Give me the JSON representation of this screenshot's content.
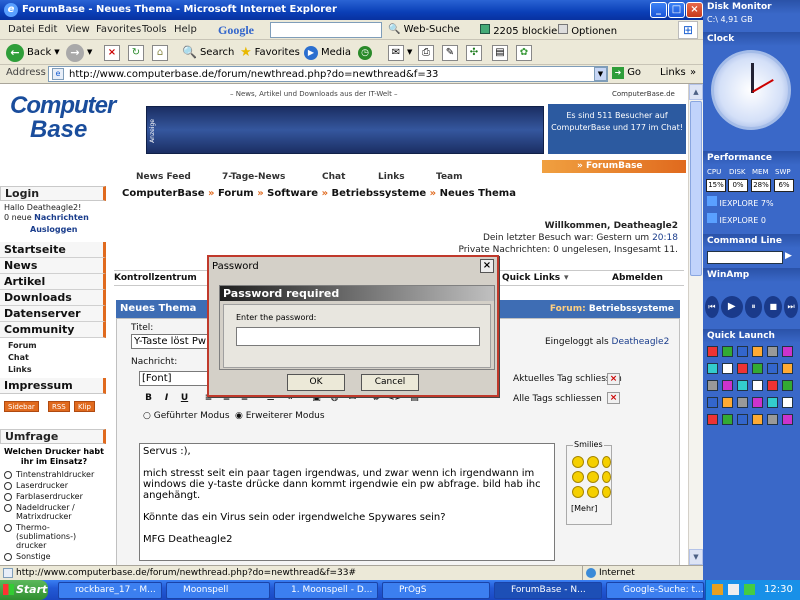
{
  "window": {
    "title": "ForumBase - Neues Thema - Microsoft Internet Explorer"
  },
  "menubar": [
    "Datei",
    "Edit",
    "View",
    "Favorites",
    "Tools",
    "Help"
  ],
  "google_toolbar": {
    "brand": "Google",
    "search_label": "Web-Suche",
    "blocked_label": "2205 blockiert",
    "options_label": "Optionen"
  },
  "toolbar": {
    "back": "Back",
    "search": "Search",
    "favorites": "Favorites",
    "media": "Media"
  },
  "address": {
    "label": "Address",
    "url": "http://www.computerbase.de/forum/newthread.php?do=newthread&f=33",
    "go": "Go",
    "links": "Links"
  },
  "banner": {
    "logo_line1": "Computer",
    "logo_line2": "Base",
    "tagline": "– News, Artikel und Downloads aus der IT-Welt –",
    "cb_link": "ComputerBase.de",
    "ad_label": "Anzeige",
    "info": "Es sind 511 Besucher auf ComputerBase und 177 im Chat!",
    "forum_tab": "» ForumBase"
  },
  "topnav": [
    "News Feed",
    "7-Tage-News",
    "Chat",
    "Links",
    "Team"
  ],
  "sidebar": {
    "login_head": "Login",
    "hallo": "Hallo Deatheagle2!",
    "new_msgs_count": "0 neue",
    "new_msgs_label": "Nachrichten",
    "logout": "Ausloggen",
    "nav": [
      "Startseite",
      "News",
      "Artikel",
      "Downloads",
      "Datenserver",
      "Community"
    ],
    "community_sub": [
      "Forum",
      "Chat",
      "Links"
    ],
    "impressum": "Impressum",
    "badges": [
      "Sidebar",
      "RSS",
      "Klip"
    ],
    "poll_head": "Umfrage",
    "poll_question": "Welchen Drucker habt ihr im Einsatz?",
    "poll_options": [
      "Tintenstrahldrucker",
      "Laserdrucker",
      "Farblaserdrucker",
      "Nadeldrucker / Matrixdrucker",
      "Thermo-(sublimations-) drucker",
      "Sonstige"
    ]
  },
  "breadcrumb": [
    "ComputerBase",
    "Forum",
    "Software",
    "Betriebssysteme",
    "Neues Thema"
  ],
  "welcome": {
    "line1": "Willkommen, Deatheagle2",
    "line2_prefix": "Dein letzter Besuch war: Gestern um",
    "line2_time": "20:18",
    "line3": "Private Nachrichten: 0 ungelesen, Insgesamt 11."
  },
  "ctrlbar": {
    "left": "Kontrollzentrum",
    "quicklinks": "Quick Links",
    "logout": "Abmelden"
  },
  "newthread": {
    "title": "Neues Thema",
    "forum_label": "Forum:",
    "forum_name": "Betriebssysteme",
    "title_label": "Titel:",
    "title_value": "Y-Taste löst Pw Abfrage aus",
    "logged_in_prefix": "Eingeloggt als",
    "logged_in_user": "Deatheagle2",
    "message_label": "Nachricht:",
    "font_select": "[Font]",
    "close_tag": "Aktuelles Tag schliessen",
    "close_all": "Alle Tags schliessen",
    "mode_guided": "Geführter Modus",
    "mode_extended": "Erweiterer Modus",
    "message_lines": [
      "Servus :),",
      "mich stresst seit ein paar tagen irgendwas, und zwar wenn ich irgendwann im windows die y-taste drücke dann kommt irgendwie ein pw abfrage. bild hab ihc angehängt.",
      "Könnte das ein Virus sein oder irgendwelche Spywares sein?",
      "MFG Deatheagle2"
    ],
    "smilies_label": "Smilies",
    "smilies_more": "[Mehr]"
  },
  "dialog": {
    "title": "Password",
    "header": "Password required",
    "prompt": "Enter the password:",
    "ok": "OK",
    "cancel": "Cancel"
  },
  "statusbar": {
    "url": "http://www.computerbase.de/forum/newthread.php?do=newthread&f=33#",
    "zone": "Internet"
  },
  "taskbar": {
    "start": "Start",
    "tasks": [
      "rockbare_17 - M...",
      "Moonspell",
      "1. Moonspell - D...",
      "PrOgS",
      "ForumBase - N...",
      "Google-Suche: t..."
    ],
    "clock": "12:30"
  },
  "rpanel": {
    "disk_monitor": "Disk Monitor",
    "disk_value": "C:\\ 4,91 GB",
    "clock": "Clock",
    "performance": "Performance",
    "perf_labels": [
      "CPU",
      "DISK",
      "MEM",
      "SWP"
    ],
    "perf_values": [
      "15%",
      "0%",
      "28%",
      "6%"
    ],
    "iexplore1": "IEXPLORE 7%",
    "iexplore2": "IEXPLORE 0",
    "command_line": "Command Line",
    "winamp": "WinAmp",
    "quick_launch": "Quick Launch"
  },
  "colors": {
    "xp_blue": "#0a3fb7",
    "cb_orange": "#e06a1e",
    "cb_blue": "#3e6db4",
    "panel_blue": "#3a68c8"
  }
}
